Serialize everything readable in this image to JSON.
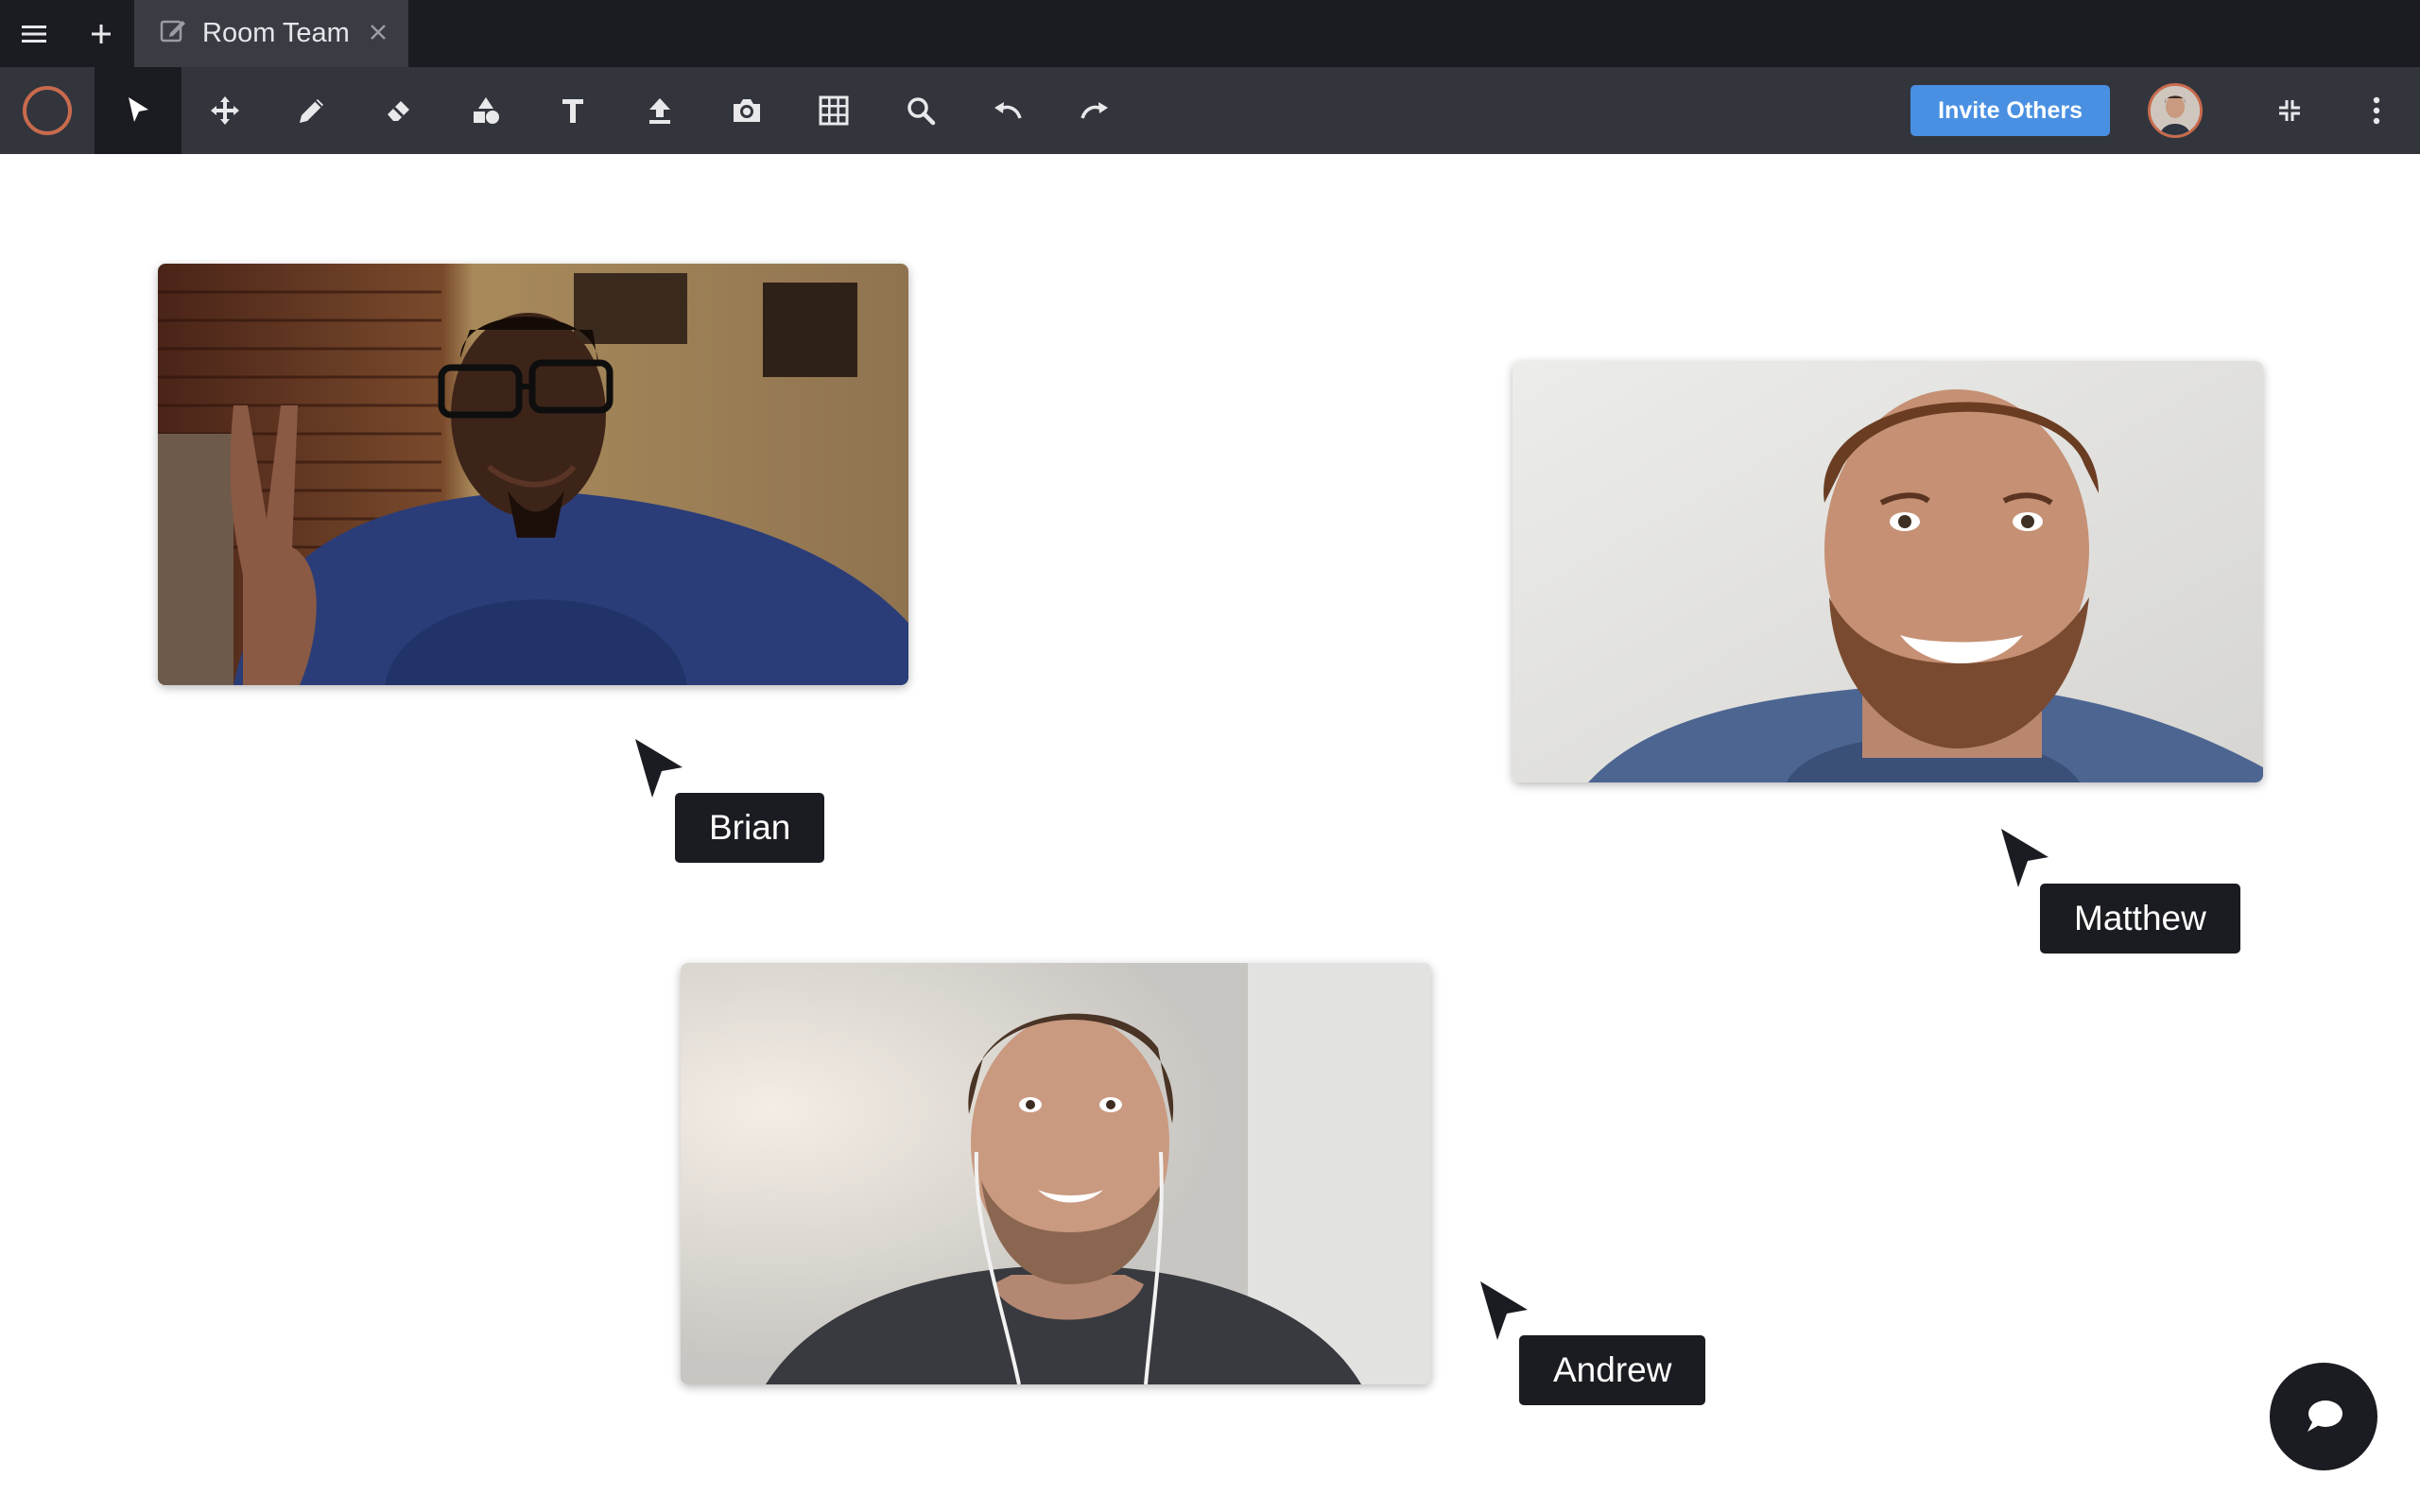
{
  "tab": {
    "title": "Room Team"
  },
  "toolbar": {
    "active_tool": "select",
    "tools": [
      "select",
      "move",
      "pen",
      "eraser",
      "shapes",
      "text",
      "upload",
      "camera",
      "table",
      "zoom",
      "undo",
      "redo"
    ],
    "invite_label": "Invite Others",
    "accent_color": "#c86b4d"
  },
  "participants": [
    {
      "name": "Brian"
    },
    {
      "name": "Matthew"
    },
    {
      "name": "Andrew"
    }
  ],
  "colors": {
    "tabbar_bg": "#1b1c21",
    "toolbar_bg": "#33353d",
    "invite_bg": "#4a90e2"
  }
}
